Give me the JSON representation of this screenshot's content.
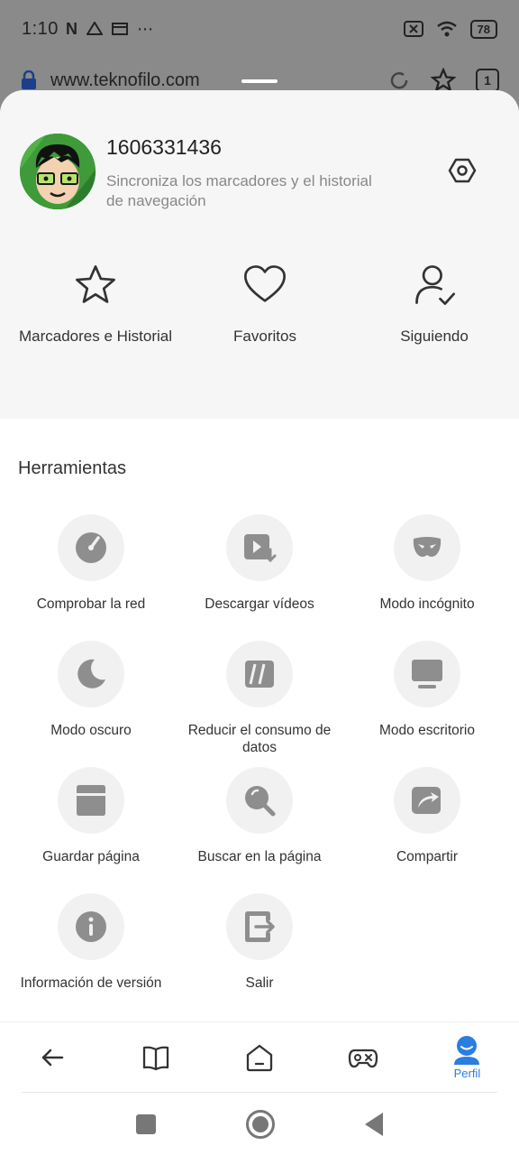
{
  "status": {
    "time": "1:10",
    "battery": "78"
  },
  "browser": {
    "url": "www.teknofilo.com",
    "tab_count": "1"
  },
  "profile": {
    "user_id": "1606331436",
    "sync_text": "Sincroniza los marcadores y el historial de navegación"
  },
  "quick_actions": [
    {
      "label": "Marcadores e Historial",
      "icon": "star-icon"
    },
    {
      "label": "Favoritos",
      "icon": "heart-icon"
    },
    {
      "label": "Siguiendo",
      "icon": "user-check-icon"
    }
  ],
  "tools_title": "Herramientas",
  "tools": [
    {
      "label": "Comprobar la red",
      "icon": "speedometer-icon"
    },
    {
      "label": "Descargar vídeos",
      "icon": "video-download-icon"
    },
    {
      "label": "Modo incógnito",
      "icon": "mask-icon"
    },
    {
      "label": "Modo oscuro",
      "icon": "moon-icon"
    },
    {
      "label": "Reducir el consumo de datos",
      "icon": "data-saver-icon"
    },
    {
      "label": "Modo escritorio",
      "icon": "desktop-icon"
    },
    {
      "label": "Guardar página",
      "icon": "save-icon"
    },
    {
      "label": "Buscar en la página",
      "icon": "find-in-page-icon"
    },
    {
      "label": "Compartir",
      "icon": "share-icon"
    },
    {
      "label": "Información de versión",
      "icon": "info-icon"
    },
    {
      "label": "Salir",
      "icon": "exit-icon"
    }
  ],
  "bottom_nav": {
    "active_label": "Perfil"
  },
  "colors": {
    "accent": "#2a7de1",
    "icon_gray": "#8e8e8e",
    "circle_bg": "#f1f1f1"
  }
}
